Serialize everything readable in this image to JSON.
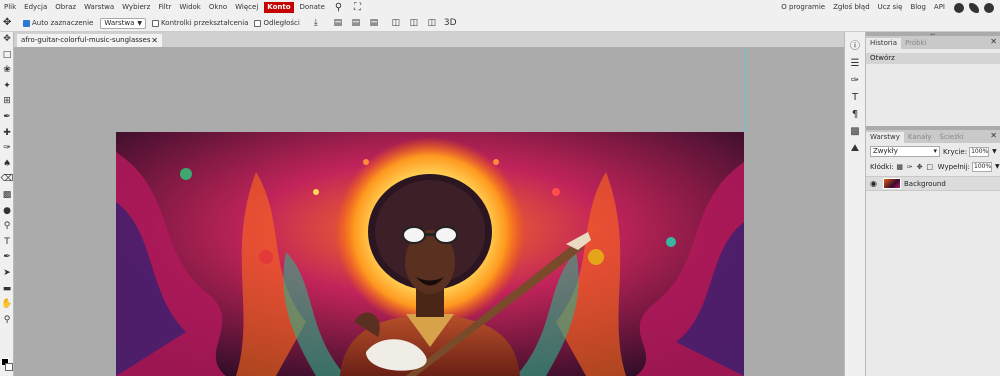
{
  "menu": {
    "items": [
      "Plik",
      "Edycja",
      "Obraz",
      "Warstwa",
      "Wybierz",
      "Filtr",
      "Widok",
      "Okno",
      "Więcej"
    ],
    "konto": "Konto",
    "donate": "Donate",
    "right_items": [
      "O programie",
      "Zgłoś błąd",
      "Ucz się",
      "Blog",
      "API"
    ]
  },
  "options": {
    "auto_select_label": "Auto zaznaczenie",
    "layer_select": "Warstwa",
    "transform_label": "Kontrolki przekształcenia",
    "distance_label": "Odległości",
    "three_d_label": "3D"
  },
  "document": {
    "tab_title": "afro-guitar-colorful-music-sunglasses"
  },
  "history_panel": {
    "tabs": [
      "Historia",
      "Próbki"
    ],
    "rows": [
      "Otwórz"
    ]
  },
  "layers_panel": {
    "tabs": [
      "Warstwy",
      "Kanały",
      "Ścieżki"
    ],
    "blend_mode": "Zwykły",
    "opacity_label": "Krycie:",
    "opacity_value": "100%",
    "locks_label": "Kłódki:",
    "fill_label": "Wypełnij:",
    "fill_value": "100%",
    "layers": [
      {
        "name": "Background"
      }
    ]
  },
  "colors": {
    "accent": "#c40000",
    "guide": "#5fc6d6",
    "foreground": "#000000",
    "background": "#ffffff"
  }
}
